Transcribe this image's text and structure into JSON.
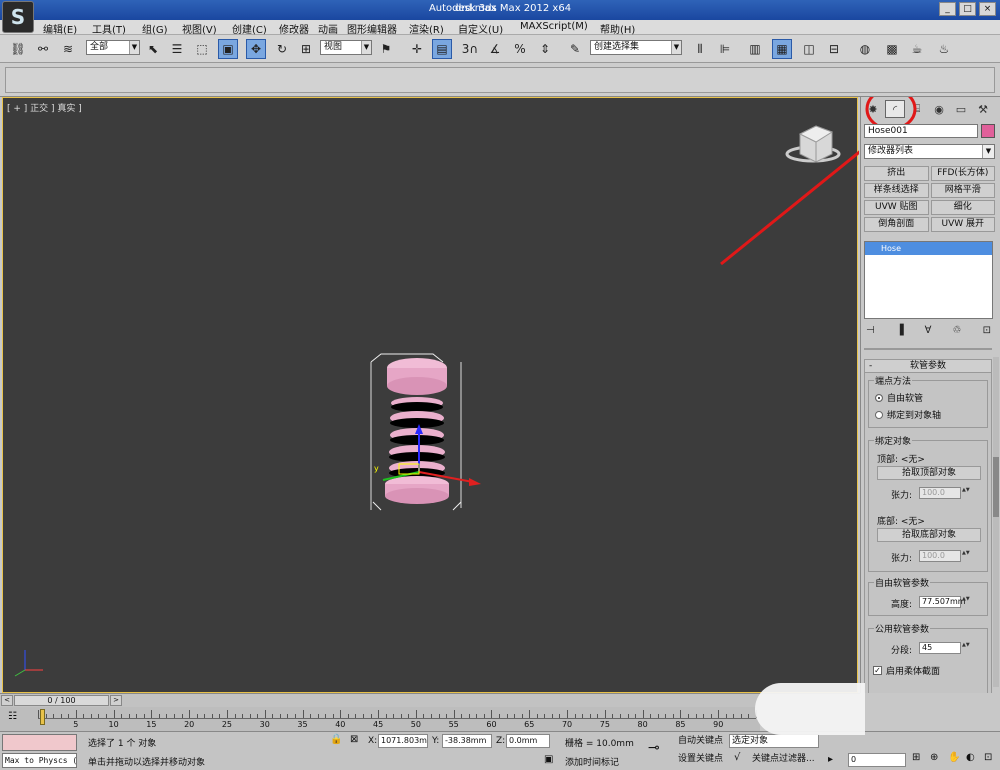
{
  "title": {
    "app": "Autodesk 3ds Max  2012 x64",
    "file": "drd.max",
    "logo": "S",
    "window_buttons": [
      "_",
      "□",
      "×"
    ]
  },
  "menu": [
    "编辑(E)",
    "工具(T)",
    "组(G)",
    "视图(V)",
    "创建(C)",
    "修改器",
    "动画",
    "图形编辑器",
    "渲染(R)",
    "自定义(U)",
    "MAXScript(M)",
    "帮助(H)"
  ],
  "toolbar": {
    "filter_value": "全部",
    "ref_coord_value": "视图",
    "named_selection_value": "创建选择集",
    "snap_label": "3",
    "percent_snap_label": "%"
  },
  "viewport": {
    "label": "[ + ] 正交 ] 真实 ]",
    "axis_y": "y",
    "gizmo_axes": [
      "x",
      "y",
      "z"
    ]
  },
  "command_panel": {
    "object_name": "Hose001",
    "object_color": "#e0609a",
    "modifier_list": "修改器列表",
    "modifier_buttons": [
      "挤出",
      "FFD(长方体)",
      "样条线选择",
      "网格平滑",
      "UVW 贴图",
      "细化",
      "倒角剖面",
      "UVW 展开"
    ],
    "stack_items": [
      "Hose"
    ],
    "rollout_title": "软管参数",
    "endpoint_group": "端点方法",
    "endpoint_options": [
      {
        "label": "自由软管",
        "selected": true
      },
      {
        "label": "绑定到对象轴",
        "selected": false
      }
    ],
    "bind_group": "绑定对象",
    "top_label": "顶部: <无>",
    "pick_top": "拾取顶部对象",
    "tension_label": "张力:",
    "tension_top": "100.0",
    "bottom_label": "底部: <无>",
    "pick_bottom": "拾取底部对象",
    "tension_bottom": "100.0",
    "free_group": "自由软管参数",
    "height_label": "高度:",
    "height_value": "77.507mm",
    "common_group": "公用软管参数",
    "segments_label": "分段:",
    "segments_value": "45",
    "flex_label": "启用柔体截面"
  },
  "timeline": {
    "frame": "0 / 100",
    "ticks": [
      5,
      10,
      15,
      20,
      25,
      30,
      35,
      40,
      45,
      50,
      55,
      60,
      65,
      70,
      75,
      80,
      85,
      90
    ]
  },
  "status": {
    "maxscript_line": "Max to Physcs (",
    "selected": "选择了 1 个 对象",
    "prompt": "单击并拖动以选择并移动对象",
    "x_label": "X:",
    "x_value": "1071.803m",
    "y_label": "Y:",
    "y_value": "-38.38mm",
    "z_label": "Z:",
    "z_value": "0.0mm",
    "grid": "栅格 = 10.0mm",
    "add_time_tag": "添加时间标记",
    "auto_key": "自动关键点",
    "set_key": "设置关键点",
    "selection_dd": "选定对象",
    "key_filters": "关键点过滤器...",
    "frame_field": "0"
  }
}
